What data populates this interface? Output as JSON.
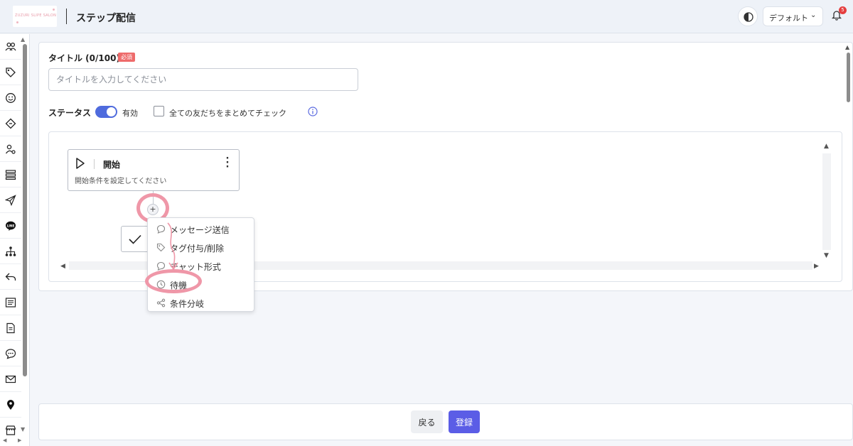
{
  "header": {
    "logo_text": "ZUZURI SLIPE SALON",
    "title": "ステップ配信",
    "workspace": "デフォルト",
    "notification_count": "5"
  },
  "sidebar": {
    "icons": [
      "users-icon",
      "tags-icon",
      "smiley-icon",
      "coupon-icon",
      "user-settings-icon",
      "list-icon",
      "send-icon",
      "line-icon",
      "hierarchy-icon",
      "reply-icon",
      "document-list-icon",
      "file-icon",
      "chat-icon",
      "mail-icon",
      "location-pin-icon",
      "shop-icon"
    ]
  },
  "form": {
    "title_label": "タイトル (0/100)",
    "required_badge": "必須",
    "title_placeholder": "タイトルを入力してください",
    "title_value": "",
    "status_label": "ステータス",
    "toggle_label": "有効",
    "toggle_on": true,
    "check_all_label": "全ての友だちをまとめてチェック",
    "check_all_checked": false
  },
  "flow": {
    "start_node": {
      "name": "開始",
      "description": "開始条件を設定してください"
    },
    "add_button": "+",
    "menu": [
      {
        "label": "メッセージ送信",
        "icon": "chat-bubble-icon"
      },
      {
        "label": "タグ付与/削除",
        "icon": "tag-icon"
      },
      {
        "label": "チャット形式",
        "icon": "chat-icon"
      },
      {
        "label": "待機",
        "icon": "clock-icon"
      },
      {
        "label": "条件分岐",
        "icon": "branch-icon"
      }
    ],
    "highlight_color": "#ef97a8"
  },
  "footer": {
    "back_label": "戻る",
    "save_label": "登録"
  },
  "colors": {
    "accent": "#5b5de6",
    "toggle": "#4f6bdd",
    "required": "#ee6b6b",
    "notification": "#e53f3f"
  }
}
